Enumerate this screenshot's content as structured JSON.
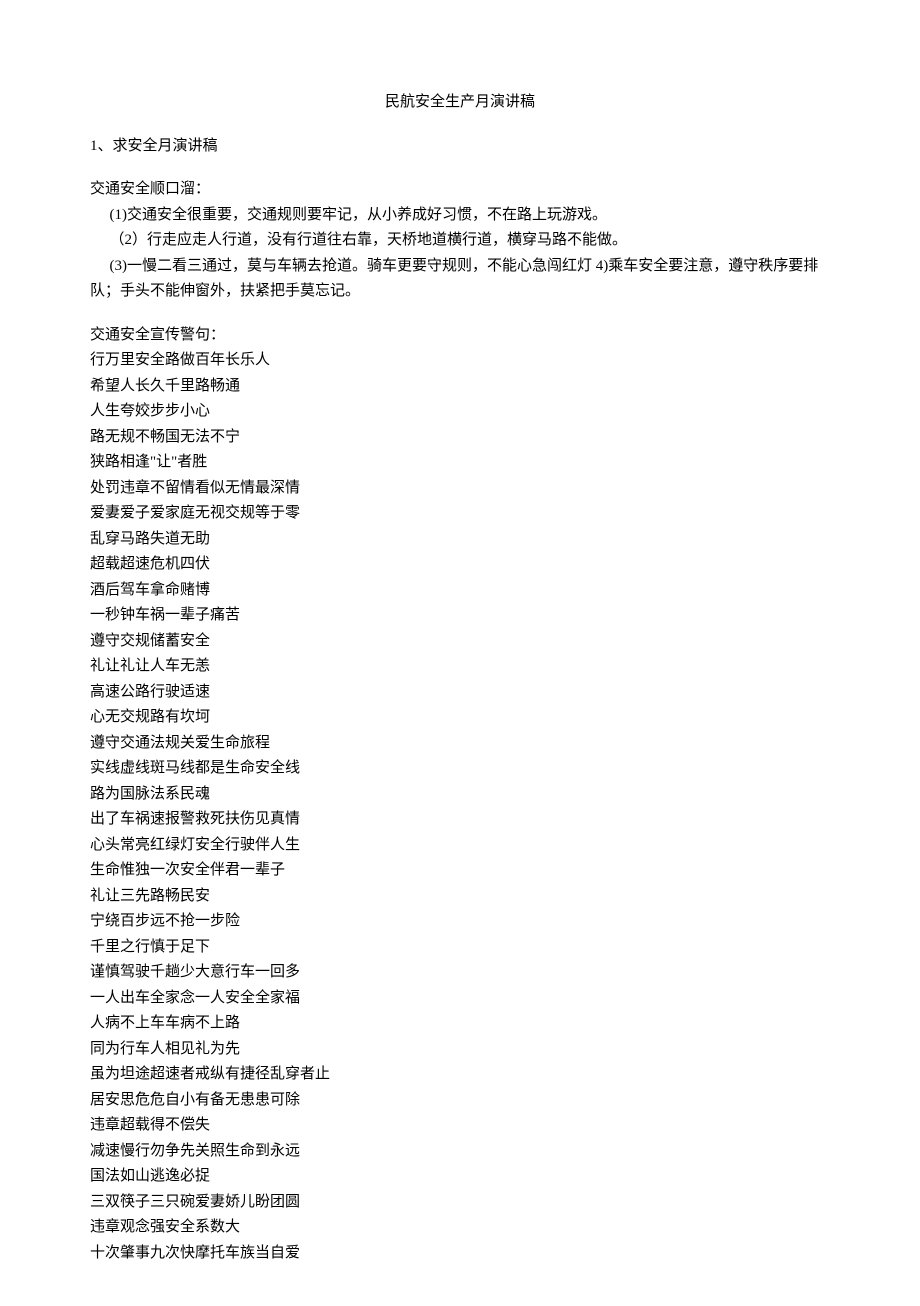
{
  "title": "民航安全生产月演讲稿",
  "section1_heading": "1、求安全月演讲稿",
  "jingle_intro": "交通安全顺口溜：",
  "jingle_lines": [
    "(1)交通安全很重要，交通规则要牢记，从小养成好习惯，不在路上玩游戏。",
    "（2）行走应走人行道，没有行道往右靠，天桥地道横行道，横穿马路不能做。",
    "(3)一慢二看三通过，莫与车辆去抢道。骑车更要守规则，不能心急闯红灯 4)乘车安全要注意，遵守秩序要排队；手头不能伸窗外，扶紧把手莫忘记。"
  ],
  "slogan_intro": "交通安全宣传警句：",
  "slogans": [
    "行万里安全路做百年长乐人",
    "希望人长久千里路畅通",
    "人生夸姣步步小心",
    "路无规不畅国无法不宁",
    "狭路相逢\"让\"者胜",
    "处罚违章不留情看似无情最深情",
    "爱妻爱子爱家庭无视交规等于零",
    "乱穿马路失道无助",
    "超载超速危机四伏",
    "酒后驾车拿命赌博",
    "一秒钟车祸一辈子痛苦",
    "遵守交规储蓄安全",
    "礼让礼让人车无恙",
    "高速公路行驶适速",
    "心无交规路有坎坷",
    "遵守交通法规关爱生命旅程",
    "实线虚线斑马线都是生命安全线",
    "路为国脉法系民魂",
    "出了车祸速报警救死扶伤见真情",
    "心头常亮红绿灯安全行驶伴人生",
    "生命惟独一次安全伴君一辈子",
    "礼让三先路畅民安",
    "宁绕百步远不抢一步险",
    "千里之行慎于足下",
    "谨慎驾驶千趟少大意行车一回多",
    "一人出车全家念一人安全全家福",
    "人病不上车车病不上路",
    "同为行车人相见礼为先",
    "虽为坦途超速者戒纵有捷径乱穿者止",
    "居安思危危自小有备无患患可除",
    "违章超载得不偿失",
    "减速慢行勿争先关照生命到永远",
    "国法如山逃逸必捉",
    "三双筷子三只碗爱妻娇儿盼团圆",
    "违章观念强安全系数大",
    "十次肇事九次快摩托车族当自爱"
  ]
}
